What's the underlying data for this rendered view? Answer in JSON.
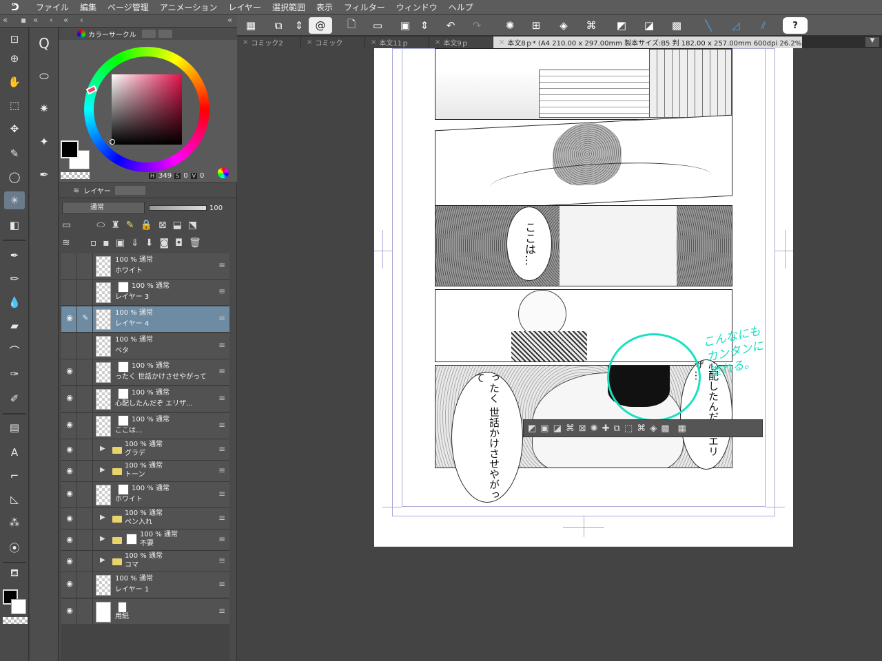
{
  "menubar": {
    "items": [
      "ファイル",
      "編集",
      "ページ管理",
      "アニメーション",
      "レイヤー",
      "選択範囲",
      "表示",
      "フィルター",
      "ウィンドウ",
      "ヘルプ"
    ]
  },
  "toolbar": {
    "help_label": "?"
  },
  "color_panel": {
    "tab_label": "カラーサークル",
    "h_chip": "H",
    "h_value": "349",
    "s_chip": "S",
    "s_value": "0",
    "v_chip": "V",
    "v_value": "0",
    "main_color": "#000000",
    "sub_color": "#ffffff"
  },
  "layer_panel": {
    "tab_label": "レイヤー",
    "blend_mode": "通常",
    "opacity": "100",
    "layers": [
      {
        "mode": "100 % 通常",
        "name": "ホワイト",
        "visible": false,
        "selected": false
      },
      {
        "mode": "100 % 通常",
        "name": "レイヤー 3",
        "visible": false,
        "selected": false
      },
      {
        "mode": "100 % 通常",
        "name": "レイヤー 4",
        "visible": true,
        "selected": true
      },
      {
        "mode": "100 % 通常",
        "name": "ベタ",
        "visible": false,
        "selected": false
      },
      {
        "mode": "100 % 通常",
        "name": "ったく 世話かけさせやがって",
        "visible": true,
        "selected": false
      },
      {
        "mode": "100 % 通常",
        "name": "心配したんだぞ エリザ...",
        "visible": true,
        "selected": false
      },
      {
        "mode": "100 % 通常",
        "name": "ここは...",
        "visible": true,
        "selected": false
      },
      {
        "mode": "100 % 通常",
        "name": "グラデ",
        "visible": true,
        "selected": false,
        "folder": true
      },
      {
        "mode": "100 % 通常",
        "name": "トーン",
        "visible": true,
        "selected": false,
        "folder": true
      },
      {
        "mode": "100 % 通常",
        "name": "ホワイト",
        "visible": true,
        "selected": false
      },
      {
        "mode": "100 % 通常",
        "name": "ペン入れ",
        "visible": true,
        "selected": false,
        "folder": true
      },
      {
        "mode": "100 % 通常",
        "name": "不要",
        "visible": true,
        "selected": false,
        "folder": true
      },
      {
        "mode": "100 % 通常",
        "name": "コマ",
        "visible": true,
        "selected": false,
        "folder": true
      },
      {
        "mode": "100 % 通常",
        "name": "レイヤー 1",
        "visible": true,
        "selected": false
      },
      {
        "mode": "",
        "name": "用紙",
        "visible": true,
        "selected": false
      }
    ]
  },
  "doc_tabs": [
    {
      "label": "コミック2",
      "active": false
    },
    {
      "label": "コミック",
      "active": false
    },
    {
      "label": "本文11ｐ",
      "active": false
    },
    {
      "label": "本文9ｐ",
      "active": false
    },
    {
      "label": "本文8ｐ* (A4 210.00 x 297.00mm 製本サイズ:B5 判 182.00 x 257.00mm 600dpi 26.2%)",
      "active": true
    }
  ],
  "manga": {
    "bubble_koko": "ここは…",
    "bubble_ttaku": "ったく 世話かけさせやがって",
    "bubble_shinpai": "心配したんだぞ エリザ…",
    "annotation": "こんなにも\nカンタンに\n塗れる。"
  },
  "colors": {
    "accent_annotation": "#19e0c0",
    "selected_layer": "#6d8ba3",
    "folder": "#e8d46a"
  }
}
